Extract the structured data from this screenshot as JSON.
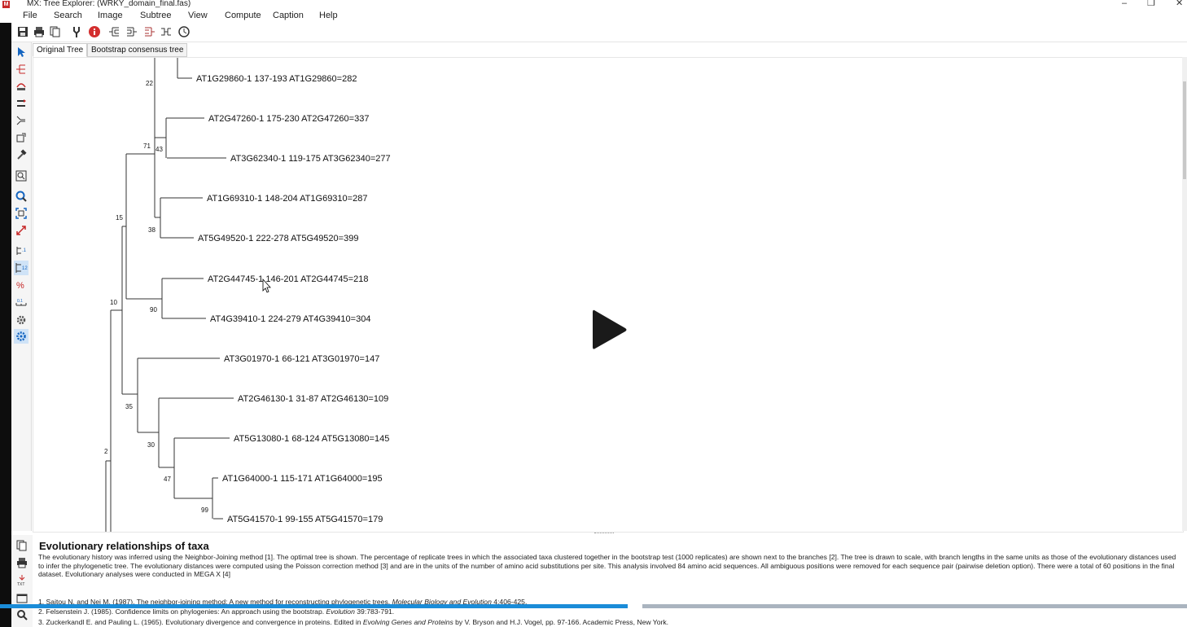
{
  "window": {
    "title": "MX: Tree Explorer: (WRKY_domain_final.fas)",
    "controls": [
      "–",
      "❐",
      "✕"
    ]
  },
  "menu": [
    "File",
    "Search",
    "Image",
    "Subtree",
    "View",
    "Compute",
    "Caption",
    "Help"
  ],
  "toolbar_icons": [
    "save-icon",
    "print-icon",
    "copy-icon",
    "options-icon",
    "info-icon",
    "tree-style-icon-1",
    "tree-style-icon-2",
    "tree-style-icon-3",
    "tree-style-icon-4",
    "clock-icon"
  ],
  "sidebar_icons": [
    "select-pointer-icon",
    "root-icon",
    "flip-icon",
    "swap-icon",
    "compress-icon",
    "subtree-icon",
    "hammer-icon",
    "search-text-icon",
    "zoom-icon",
    "fit-window-icon",
    "resize-icon",
    "branch-length-icon",
    "bootstrap-icon",
    "percent-icon",
    "scale-bar-icon",
    "settings-gear-icon",
    "settings-active-icon"
  ],
  "tabs": [
    "Original Tree",
    "Bootstrap consensus tree"
  ],
  "tree": {
    "taxa": [
      "AT1G29860-1 137-193 AT1G29860=282",
      "AT2G47260-1 175-230 AT2G47260=337",
      "AT3G62340-1 119-175 AT3G62340=277",
      "AT1G69310-1 148-204 AT1G69310=287",
      "AT5G49520-1 222-278 AT5G49520=399",
      "AT2G44745-1 146-201 AT2G44745=218",
      "AT4G39410-1 224-279 AT4G39410=304",
      "AT3G01970-1 66-121 AT3G01970=147",
      "AT2G46130-1 31-87 AT2G46130=109",
      "AT5G13080-1 68-124 AT5G13080=145",
      "AT1G64000-1 115-171 AT1G64000=195",
      "AT5G41570-1 99-155 AT5G41570=179"
    ],
    "bootstrap_values": [
      "22",
      "71",
      "43",
      "15",
      "38",
      "90",
      "10",
      "35",
      "30",
      "2",
      "47",
      "99"
    ]
  },
  "caption": {
    "title": "Evolutionary relationships of taxa",
    "body": "The evolutionary history was inferred using the Neighbor-Joining method [1]. The optimal tree is shown. The percentage of replicate trees in which the associated taxa clustered together in the bootstrap test (1000 replicates) are shown next to the branches [2]. The tree is drawn to scale, with branch lengths in the same units as those of the evolutionary distances used to infer the phylogenetic tree. The evolutionary distances were computed using the Poisson correction method [3] and are in the units of the number of amino acid substitutions per site. This analysis involved 84 amino acid sequences. All ambiguous positions were removed for each sequence pair (pairwise deletion option). There were a total of 60 positions in the final dataset. Evolutionary analyses were conducted in MEGA X [4]",
    "references": [
      {
        "pre": "1. Saitou N. and Nei M. (1987). The neighbor-joining method: A new method for reconstructing phylogenetic trees. ",
        "journal": "Molecular Biology and Evolution",
        "post": " 4:406-425."
      },
      {
        "pre": "2. Felsenstein J. (1985). Confidence limits on phylogenies: An approach using the bootstrap. ",
        "journal": "Evolution",
        "post": " 39:783-791."
      },
      {
        "pre": "3. Zuckerkandl E. and Pauling L. (1965). Evolutionary divergence and convergence in proteins. Edited in ",
        "journal": "Evolving Genes and Proteins",
        "post": " by V. Bryson and H.J. Vogel, pp. 97-166. Academic Press, New York."
      }
    ]
  },
  "caption_toolbar_icons": [
    "copy-icon",
    "print-icon",
    "export-txt-icon",
    "window-icon",
    "zoom-icon"
  ],
  "video": {
    "progress": 0.529,
    "play_icon": "play-icon"
  },
  "colors": {
    "progress_fill": "#1a8cd8",
    "progress_track": "#aab4bf",
    "info_icon": "#d32f2f"
  }
}
